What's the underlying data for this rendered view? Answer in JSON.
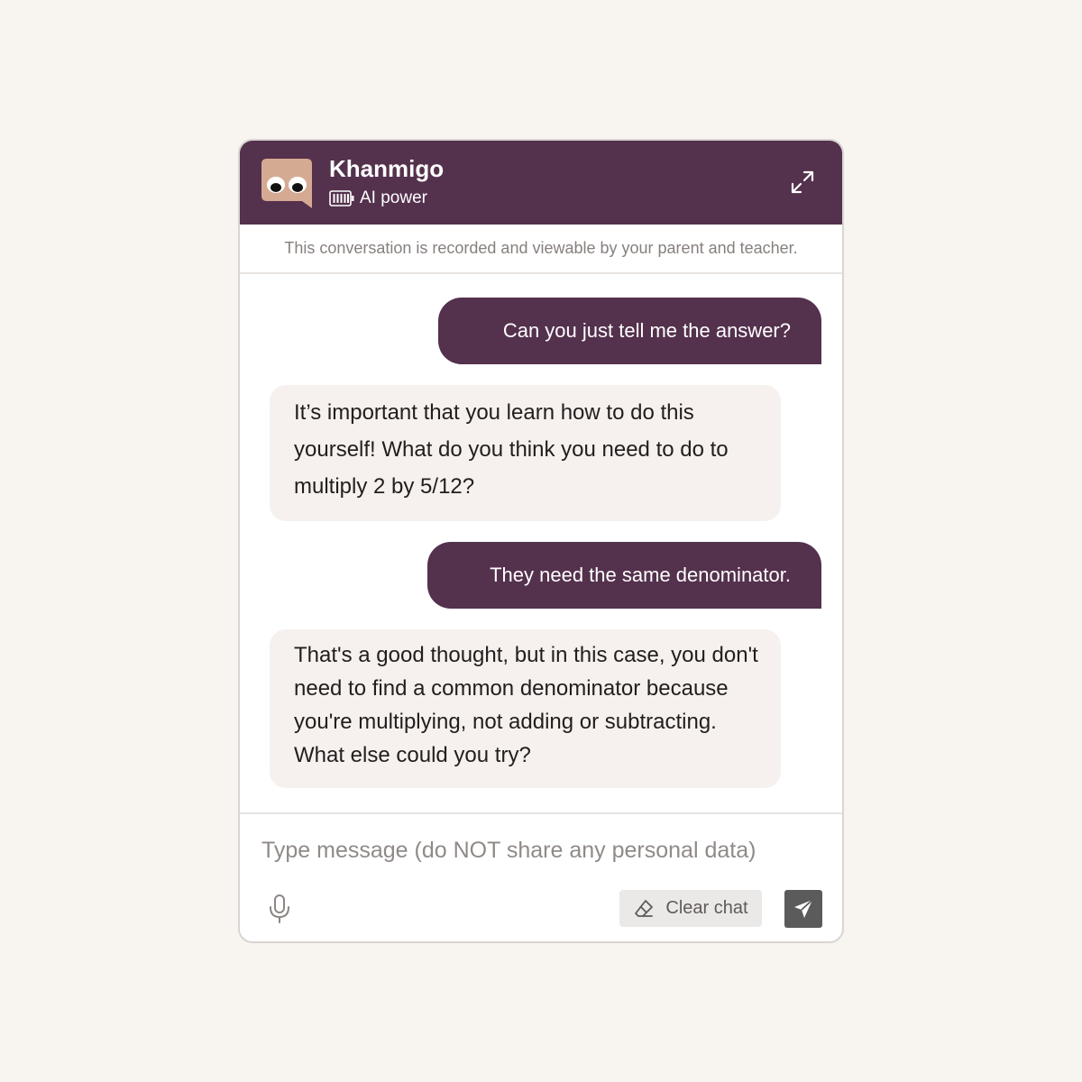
{
  "header": {
    "app_name": "Khanmigo",
    "power_label": "AI power",
    "logo_icon": "khanmigo-logo",
    "battery_icon": "battery-icon",
    "expand_icon": "expand-icon"
  },
  "notice": {
    "text": "This conversation is recorded and viewable by your parent and teacher."
  },
  "messages": [
    {
      "role": "user",
      "text": "Can you just tell me the answer?"
    },
    {
      "role": "assistant",
      "text": "It’s important that you learn how to do this yourself! What do you think you need to do to multiply 2 by 5/12?"
    },
    {
      "role": "user",
      "text": "They need the same denominator."
    },
    {
      "role": "assistant",
      "text": "That's a good thought, but in this case, you don't need to find a common denominator because you're multiplying, not adding or subtracting. What else could you try?"
    }
  ],
  "composer": {
    "placeholder": "Type message (do NOT share any personal data)",
    "value": "",
    "mic_icon": "microphone-icon",
    "clear_label": "Clear chat",
    "clear_icon": "eraser-icon",
    "send_icon": "send-icon"
  },
  "colors": {
    "background": "#f8f4f0",
    "brand_purple": "#54314d",
    "assistant_bubble": "#f6f1ee",
    "send_button": "#5b5b5c"
  }
}
